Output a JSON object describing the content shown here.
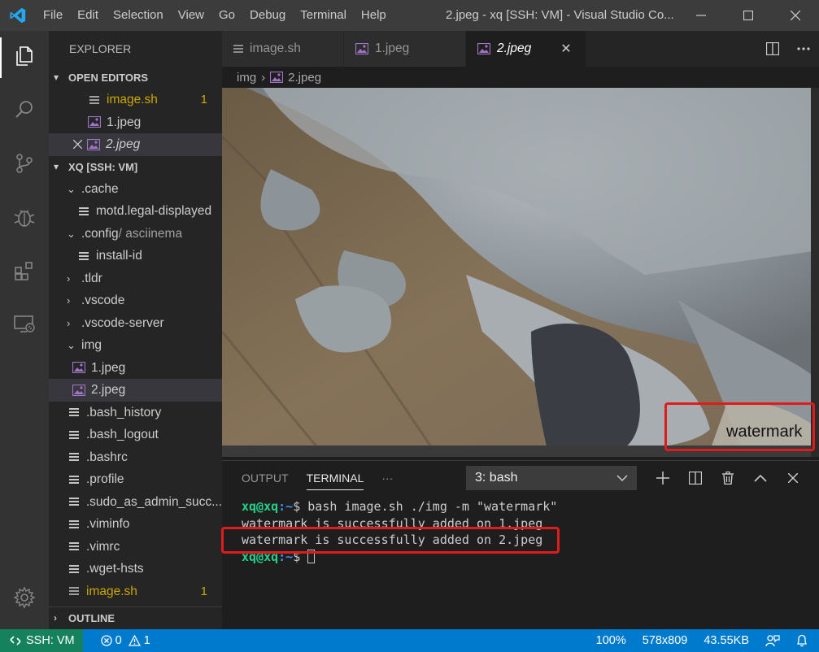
{
  "titlebar": {
    "menu": [
      "File",
      "Edit",
      "Selection",
      "View",
      "Go",
      "Debug",
      "Terminal",
      "Help"
    ],
    "title": "2.jpeg - xq [SSH: VM] - Visual Studio Co..."
  },
  "sidebar": {
    "title": "EXPLORER",
    "open_editors_label": "OPEN EDITORS",
    "open_editors": [
      {
        "name": "image.sh",
        "badge": "1"
      },
      {
        "name": "1.jpeg"
      },
      {
        "name": "2.jpeg"
      }
    ],
    "workspace_label": "XQ [SSH: VM]",
    "tree": [
      {
        "name": ".cache"
      },
      {
        "name": "motd.legal-displayed"
      },
      {
        "name": ".config",
        "suffix": " / asciinema"
      },
      {
        "name": "install-id"
      },
      {
        "name": ".tldr"
      },
      {
        "name": ".vscode"
      },
      {
        "name": ".vscode-server"
      },
      {
        "name": "img"
      },
      {
        "name": "1.jpeg"
      },
      {
        "name": "2.jpeg"
      },
      {
        "name": ".bash_history"
      },
      {
        "name": ".bash_logout"
      },
      {
        "name": ".bashrc"
      },
      {
        "name": ".profile"
      },
      {
        "name": ".sudo_as_admin_succ..."
      },
      {
        "name": ".viminfo"
      },
      {
        "name": ".vimrc"
      },
      {
        "name": ".wget-hsts"
      },
      {
        "name": "image.sh",
        "badge": "1"
      }
    ],
    "outline_label": "OUTLINE"
  },
  "tabs": [
    {
      "label": "image.sh"
    },
    {
      "label": "1.jpeg"
    },
    {
      "label": "2.jpeg"
    }
  ],
  "breadcrumb": {
    "folder": "img",
    "file": "2.jpeg"
  },
  "image": {
    "watermark_text": "watermark"
  },
  "panel": {
    "tabs": [
      "OUTPUT",
      "TERMINAL"
    ],
    "more": "···",
    "terminal_select": "3: bash",
    "prompt_user": "xq@xq",
    "prompt_path": ":~",
    "prompt_symbol": "$",
    "command": " bash image.sh ./img -m \"watermark\"",
    "output": [
      "watermark is successfully added on 1.jpeg",
      "watermark is successfully added on 2.jpeg"
    ]
  },
  "statusbar": {
    "remote": "SSH: VM",
    "errors": "0",
    "warnings": "1",
    "zoom": "100%",
    "dimensions": "578x809",
    "filesize": "43.55KB"
  },
  "colors": {
    "accent": "#007acc",
    "remote": "#16825d",
    "highlight_box": "#e01b1b",
    "warning": "#cca700"
  }
}
